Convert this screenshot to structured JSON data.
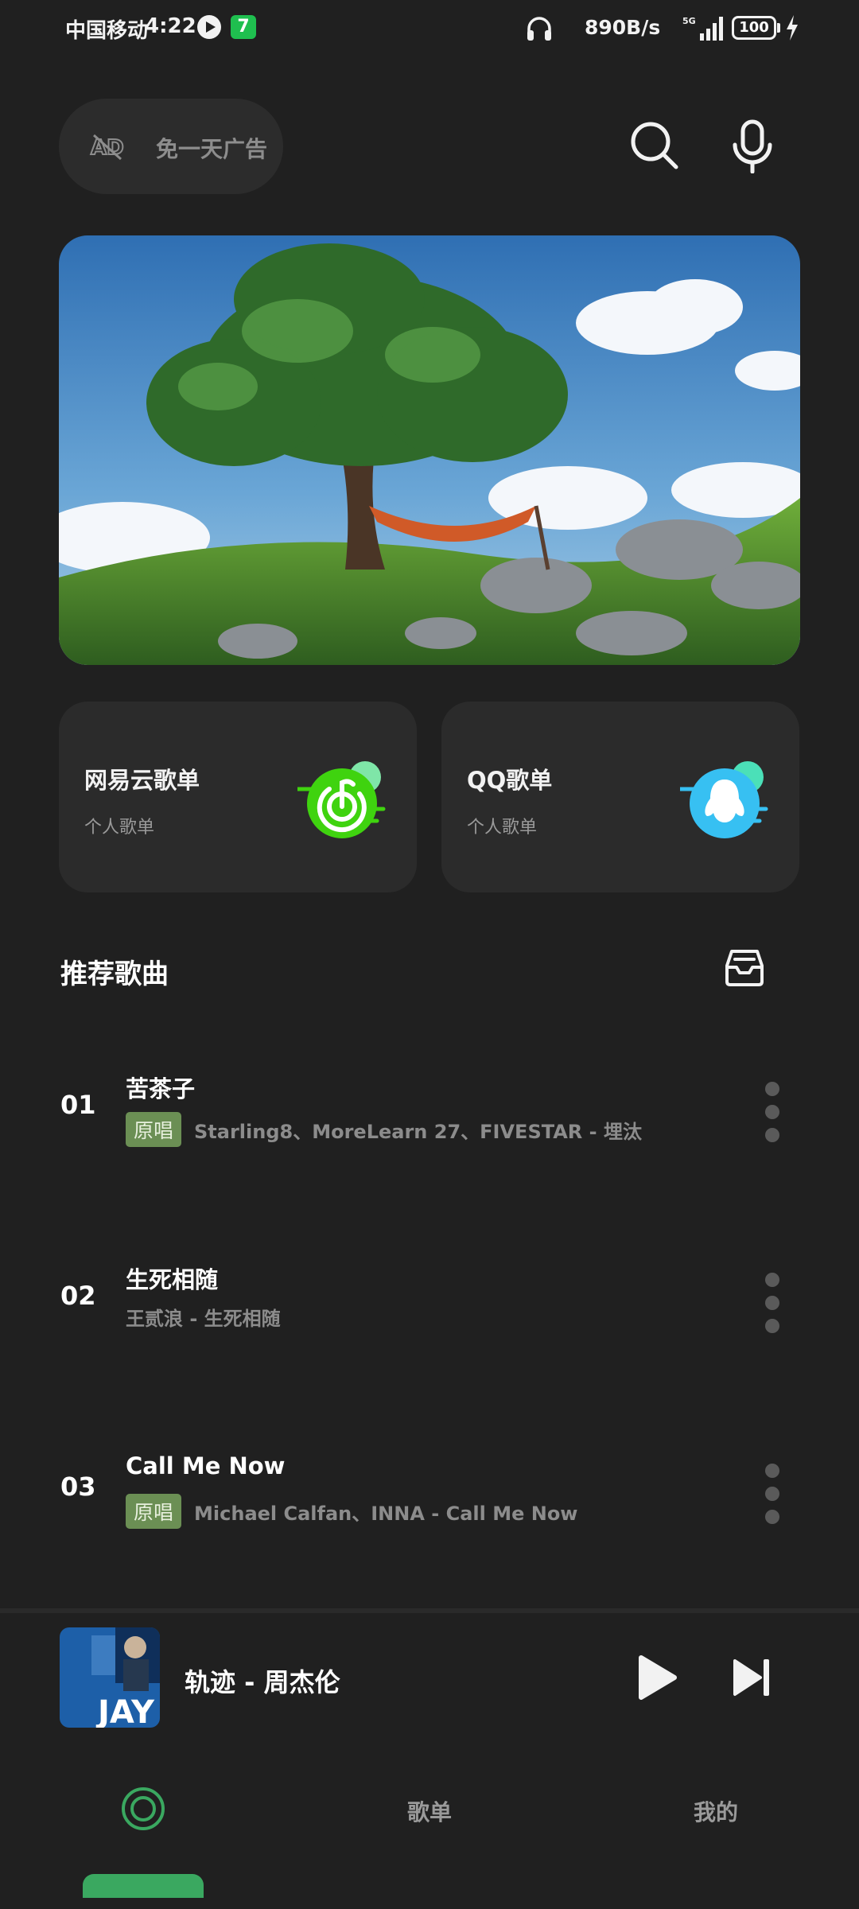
{
  "status_bar": {
    "carrier": "中国移动",
    "time": "4:22",
    "badge_number": "7",
    "net_speed": "890B/s",
    "network": "5G",
    "battery": "100"
  },
  "top_bar": {
    "ad_free_label": "免一天广告",
    "icons": [
      "no-ads-icon",
      "search-icon",
      "microphone-icon"
    ]
  },
  "banner": {
    "description_icon": "banner-image"
  },
  "playlist_cards": [
    {
      "title": "网易云歌单",
      "subtitle": "个人歌单",
      "icon": "netease-music-icon"
    },
    {
      "title": "QQ歌单",
      "subtitle": "个人歌单",
      "icon": "qq-music-icon"
    }
  ],
  "recommended": {
    "title": "推荐歌曲",
    "songs": [
      {
        "index": "01",
        "name": "苦茶子",
        "tag": "原唱",
        "artist": "Starling8、MoreLearn 27、FIVESTAR - 埋汰"
      },
      {
        "index": "02",
        "name": "生死相随",
        "tag": "",
        "artist": "王贰浪 - 生死相随"
      },
      {
        "index": "03",
        "name": "Call Me Now",
        "tag": "原唱",
        "artist": "Michael Calfan、INNA - Call Me Now"
      }
    ]
  },
  "now_playing": {
    "title": "轨迹 - 周杰伦",
    "cover_text": "JAY"
  },
  "bottom_nav": {
    "items": [
      {
        "label": "",
        "icon": "home-disc-icon",
        "active": true
      },
      {
        "label": "歌单",
        "active": false
      },
      {
        "label": "我的",
        "active": false
      }
    ]
  },
  "colors": {
    "background": "#202020",
    "card": "#2b2b2b",
    "accent_green": "#3aa860",
    "tag_green": "#6b8f54",
    "netease_green": "#3fd30f",
    "qq_blue": "#37c0f2"
  }
}
